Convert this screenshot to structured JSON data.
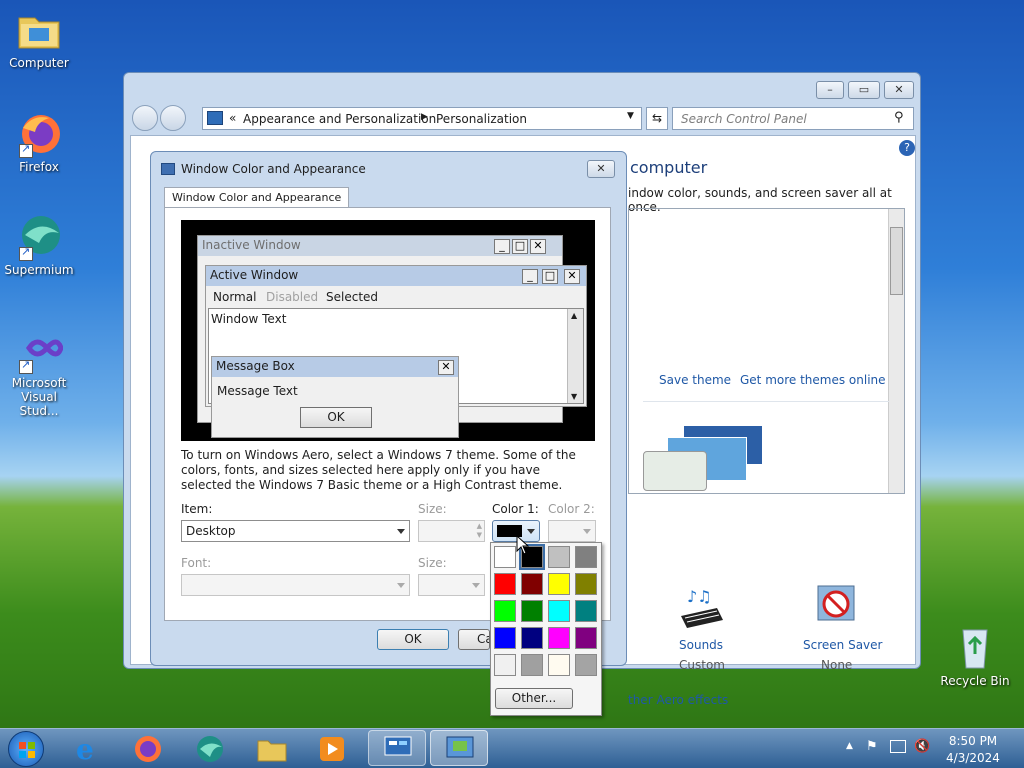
{
  "desktop": {
    "icons": [
      {
        "label": "Computer"
      },
      {
        "label": "Firefox"
      },
      {
        "label": "Supermium"
      },
      {
        "label": "Microsoft Visual Stud..."
      },
      {
        "label": "Recycle Bin"
      }
    ]
  },
  "control_panel": {
    "breadcrumb_sep": "«",
    "breadcrumb": [
      "Appearance and Personalization",
      "Personalization"
    ],
    "search_placeholder": "Search Control Panel",
    "heading_fragment": "computer",
    "subtext_fragment": "indow color, sounds, and screen saver all at once.",
    "save_theme": "Save theme",
    "get_more_themes": "Get more themes online",
    "sounds_label": "Sounds",
    "sounds_value": "Custom",
    "screensaver_label": "Screen Saver",
    "screensaver_value": "None",
    "aero_effects_fragment": "ther Aero effects"
  },
  "dialog": {
    "title": "Window Color and Appearance",
    "tab": "Window Color and Appearance",
    "preview": {
      "inactive": "Inactive Window",
      "active": "Active Window",
      "menu_normal": "Normal",
      "menu_disabled": "Disabled",
      "menu_selected": "Selected",
      "window_text": "Window Text",
      "message_box": "Message Box",
      "message_text": "Message Text",
      "ok": "OK"
    },
    "info": "To turn on Windows Aero, select a Windows 7 theme.  Some of the colors, fonts, and sizes selected here apply only if you have selected the Windows 7 Basic theme or a High Contrast theme.",
    "item_label": "Item:",
    "item_value": "Desktop",
    "size_label": "Size:",
    "color1_label": "Color 1:",
    "color2_label": "Color 2:",
    "font_label": "Font:",
    "size2_label": "Size:",
    "ok": "OK",
    "cancel_fragment": "Ca"
  },
  "palette": {
    "colors": [
      "#ffffff",
      "#000000",
      "#c0c0c0",
      "#808080",
      "#ff0000",
      "#800000",
      "#ffff00",
      "#808000",
      "#00ff00",
      "#008000",
      "#00ffff",
      "#008080",
      "#0000ff",
      "#000080",
      "#ff00ff",
      "#800080",
      "#f0f0f0",
      "#a0a0a0",
      "#fffbf0",
      "#a4a4a4"
    ],
    "other": "Other..."
  },
  "taskbar": {
    "time": "8:50 PM",
    "date": "4/3/2024"
  }
}
